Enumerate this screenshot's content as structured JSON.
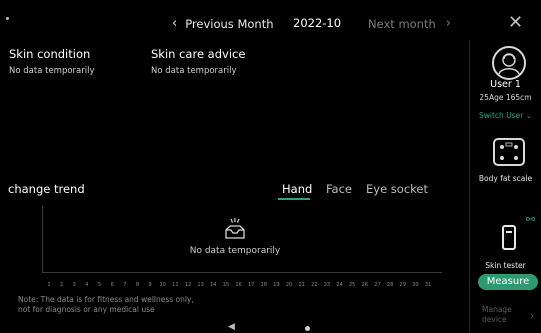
{
  "header": {
    "prev_label": "Previous Month",
    "current_month": "2022-10",
    "next_label": "Next month"
  },
  "skin_condition": {
    "title": "Skin condition",
    "value": "No data temporarily"
  },
  "skin_care_advice": {
    "title": "Skin care advice",
    "value": "No data temporarily"
  },
  "trend": {
    "title": "change trend",
    "tabs": [
      "Hand",
      "Face",
      "Eye socket"
    ],
    "active_tab": "Hand",
    "empty_text": "No data temporarily",
    "days": [
      "1",
      "2",
      "3",
      "4",
      "5",
      "6",
      "7",
      "8",
      "9",
      "10",
      "11",
      "12",
      "13",
      "14",
      "15",
      "16",
      "17",
      "18",
      "19",
      "20",
      "21",
      "22",
      "23",
      "24",
      "25",
      "26",
      "27",
      "28",
      "29",
      "30",
      "31"
    ]
  },
  "note": {
    "line1": "Note: The data is for fitness and wellness only,",
    "line2": "not for diagnosis or any medical use"
  },
  "sidebar": {
    "user_name": "User 1",
    "user_info": "25Age 165cm",
    "switch_user": "Switch User",
    "devices": [
      {
        "label": "Body fat scale"
      },
      {
        "label": "Skin tester"
      }
    ],
    "measure_label": "Measure",
    "manage_line1": "Manage",
    "manage_line2": "device"
  },
  "colors": {
    "accent": "#2fa37a",
    "background": "#000000"
  },
  "icons": {
    "prev": "chevron-left-icon",
    "next": "chevron-right-icon",
    "close": "close-icon",
    "avatar": "user-avatar-icon",
    "scale": "scale-icon",
    "tester": "skin-tester-icon",
    "link": "link-icon",
    "empty": "empty-tray-icon",
    "back": "back-triangle-icon",
    "home": "home-dot-icon"
  }
}
